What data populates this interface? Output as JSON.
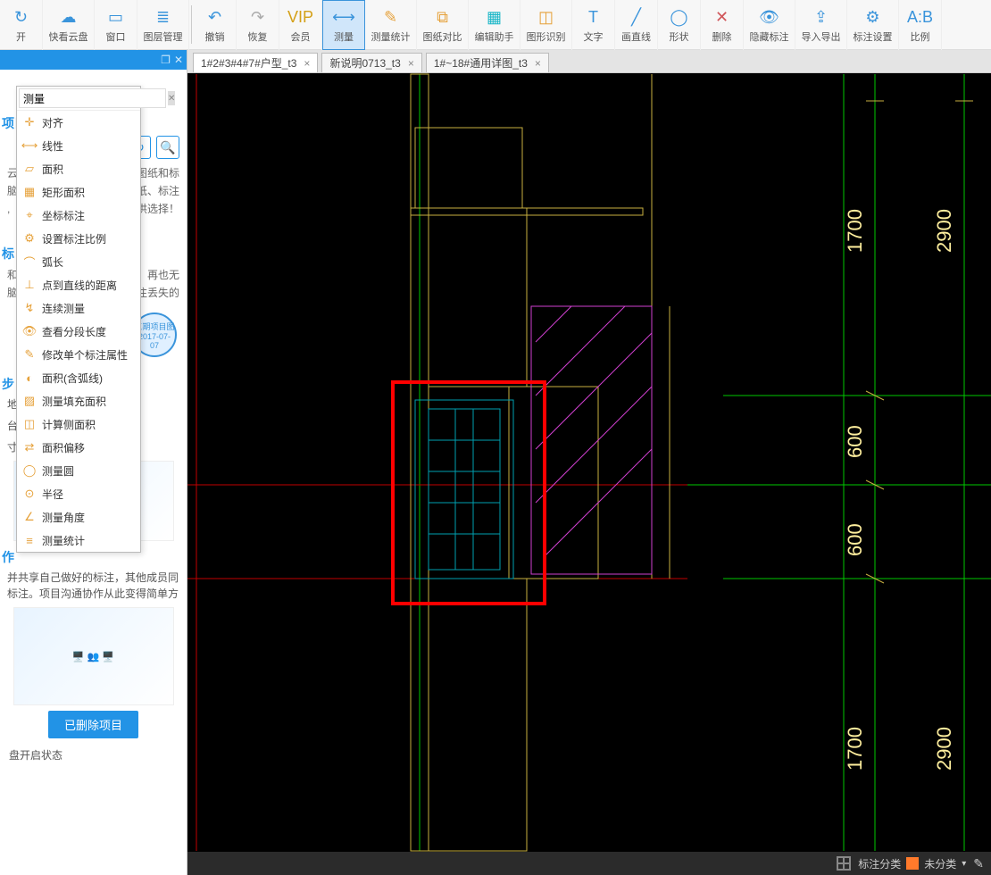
{
  "toolbar": [
    {
      "label": "开",
      "icon": "↻",
      "cls": "ic-blue"
    },
    {
      "label": "快看云盘",
      "icon": "☁",
      "cls": "ic-blue",
      "wide": true
    },
    {
      "label": "窗口",
      "icon": "▭",
      "cls": "ic-blue"
    },
    {
      "label": "图层管理",
      "icon": "≣",
      "cls": "ic-blue",
      "wide": true
    },
    {
      "label": "",
      "sep": true
    },
    {
      "label": "撤销",
      "icon": "↶",
      "cls": "ic-blue"
    },
    {
      "label": "恢复",
      "icon": "↷",
      "cls": "ic-gray"
    },
    {
      "label": "会员",
      "icon": "VIP",
      "cls": "ic-gold"
    },
    {
      "label": "测量",
      "icon": "⟷",
      "cls": "ic-blue",
      "active": true
    },
    {
      "label": "测量统计",
      "icon": "✎",
      "cls": "ic-orange",
      "wide": true
    },
    {
      "label": "图纸对比",
      "icon": "⧉",
      "cls": "ic-orange",
      "wide": true
    },
    {
      "label": "编辑助手",
      "icon": "▦",
      "cls": "ic-teal",
      "wide": true
    },
    {
      "label": "图形识别",
      "icon": "◫",
      "cls": "ic-orange",
      "wide": true
    },
    {
      "label": "文字",
      "icon": "T",
      "cls": "ic-blue"
    },
    {
      "label": "画直线",
      "icon": "╱",
      "cls": "ic-blue"
    },
    {
      "label": "形状",
      "icon": "◯",
      "cls": "ic-blue"
    },
    {
      "label": "删除",
      "icon": "✕",
      "cls": "ic-red"
    },
    {
      "label": "隐藏标注",
      "icon": "👁",
      "cls": "ic-blue",
      "wide": true
    },
    {
      "label": "导入导出",
      "icon": "⇪",
      "cls": "ic-blue",
      "wide": true
    },
    {
      "label": "标注设置",
      "icon": "⚙",
      "cls": "ic-blue",
      "wide": true
    },
    {
      "label": "比例",
      "icon": "A:B",
      "cls": "ic-blue"
    }
  ],
  "tabs": [
    {
      "label": "1#2#3#4#7#户型_t3",
      "active": true
    },
    {
      "label": "新说明0713_t3",
      "active": false
    },
    {
      "label": "1#~18#通用详图_t3",
      "active": false
    }
  ],
  "sidebar": {
    "search_placeholder": "测量",
    "refresh_icon": "↻",
    "search_icon": "🔍",
    "bg_hint1": "步图纸和标",
    "bg_hint2": "图纸、标注",
    "bg_hint3": "可供选择！",
    "bg_hint4": "，再也无",
    "bg_hint5": "注丢失的",
    "section1_title": "标",
    "section2_title": "步",
    "section3_title": "作",
    "para1_a": "地和",
    "para1_b": "台就",
    "para1_c": "寸随地，",
    "para2": "并共享自己做好的标注，其他成员同标注。项目沟通协作从此变得简单方",
    "delete_btn": "已删除项目",
    "status": "盘开启状态"
  },
  "dropdown": {
    "search_value": "测量",
    "items": [
      {
        "icon": "✛",
        "label": "对齐"
      },
      {
        "icon": "⟷",
        "label": "线性"
      },
      {
        "icon": "▱",
        "label": "面积"
      },
      {
        "icon": "▦",
        "label": "矩形面积"
      },
      {
        "icon": "⌖",
        "label": "坐标标注"
      },
      {
        "icon": "⚙",
        "label": "设置标注比例"
      },
      {
        "icon": "⌒",
        "label": "弧长"
      },
      {
        "icon": "⊥",
        "label": "点到直线的距离"
      },
      {
        "icon": "↯",
        "label": "连续测量"
      },
      {
        "icon": "👁",
        "label": "查看分段长度"
      },
      {
        "icon": "✎",
        "label": "修改单个标注属性"
      },
      {
        "icon": "◐",
        "label": "面积(含弧线)"
      },
      {
        "icon": "▨",
        "label": "测量填充面积"
      },
      {
        "icon": "◫",
        "label": "计算侧面积"
      },
      {
        "icon": "⇄",
        "label": "面积偏移"
      },
      {
        "icon": "◯",
        "label": "测量圆"
      },
      {
        "icon": "⊙",
        "label": "半径"
      },
      {
        "icon": "∠",
        "label": "测量角度"
      },
      {
        "icon": "≡",
        "label": "测量统计"
      }
    ]
  },
  "canvas_dims": [
    "1700",
    "2900",
    "600",
    "600",
    "1700",
    "2900"
  ],
  "statusbar": {
    "category_label": "标注分类",
    "category_value": "未分类"
  }
}
